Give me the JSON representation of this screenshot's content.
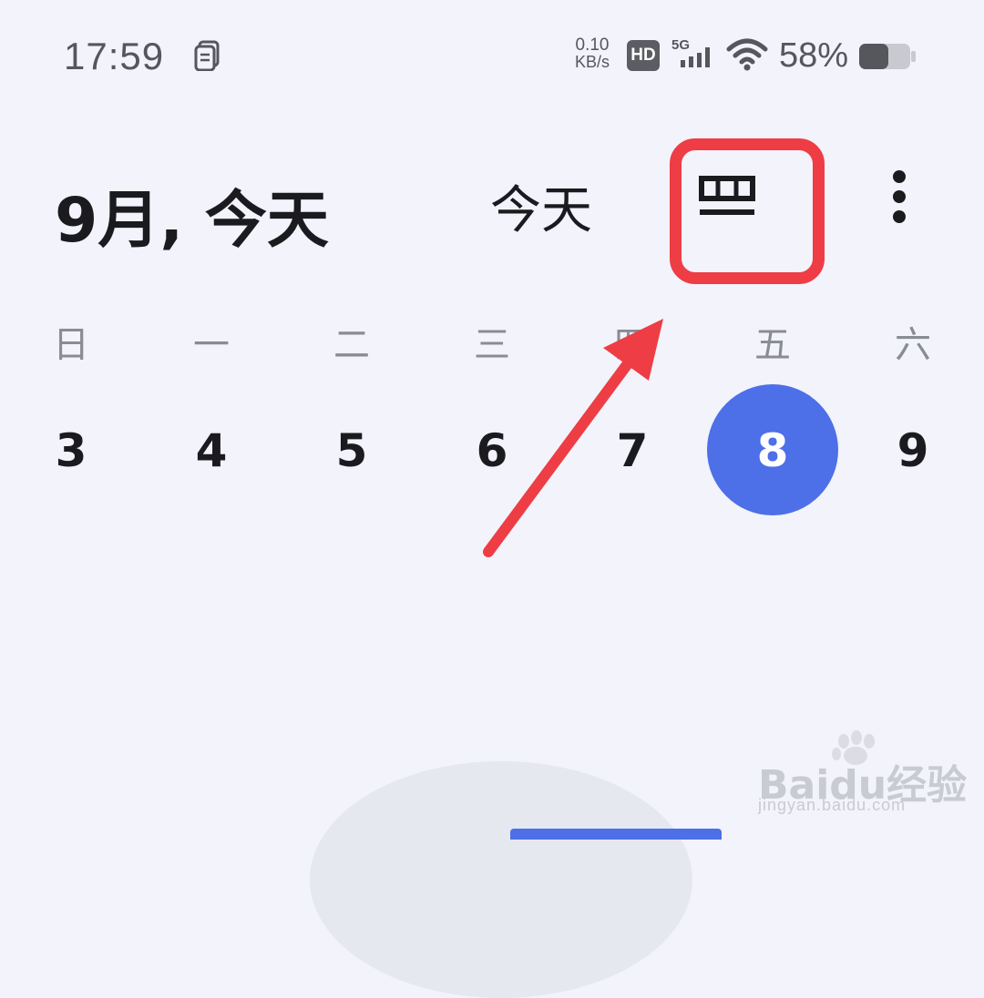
{
  "status_bar": {
    "time": "17:59",
    "net_speed_value": "0.10",
    "net_speed_unit": "KB/s",
    "hd_label": "HD",
    "network_label": "5G",
    "battery_percent": "58%",
    "battery_level": 0.58
  },
  "header": {
    "title": "9月, 今天",
    "today_button": "今天",
    "view_icon": "calendar-view-icon",
    "more_icon": "more-vert-icon"
  },
  "week": {
    "weekdays": [
      "日",
      "一",
      "二",
      "三",
      "四",
      "五",
      "六"
    ],
    "dates": [
      "3",
      "4",
      "5",
      "6",
      "7",
      "8",
      "9"
    ],
    "selected_index": 5
  },
  "colors": {
    "accent": "#4d6fe8",
    "annotation": "#ee3d44",
    "background": "#f2f3fb"
  },
  "watermark": {
    "brand": "Baidu经验",
    "url": "jingyan.baidu.com"
  }
}
